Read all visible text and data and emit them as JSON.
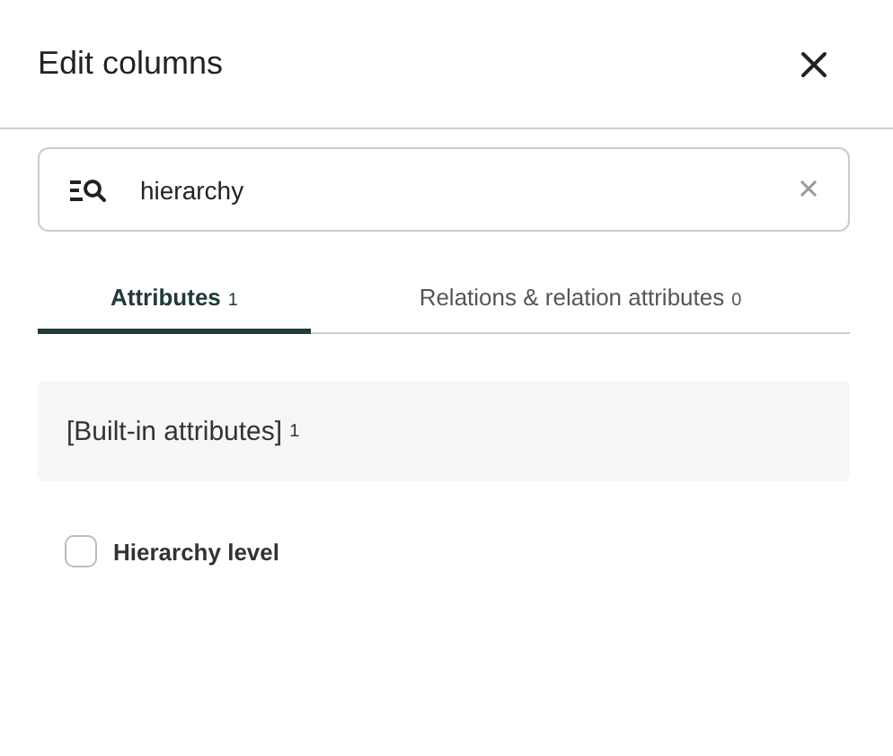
{
  "dialog": {
    "title": "Edit columns"
  },
  "search": {
    "value": "hierarchy"
  },
  "tabs": [
    {
      "label": "Attributes",
      "count": "1",
      "selected": true
    },
    {
      "label": "Relations & relation attributes",
      "count": "0",
      "selected": false
    }
  ],
  "groups": [
    {
      "title": "[Built-in attributes]",
      "count": "1",
      "items": [
        {
          "label": "Hierarchy level",
          "checked": false
        }
      ]
    }
  ]
}
